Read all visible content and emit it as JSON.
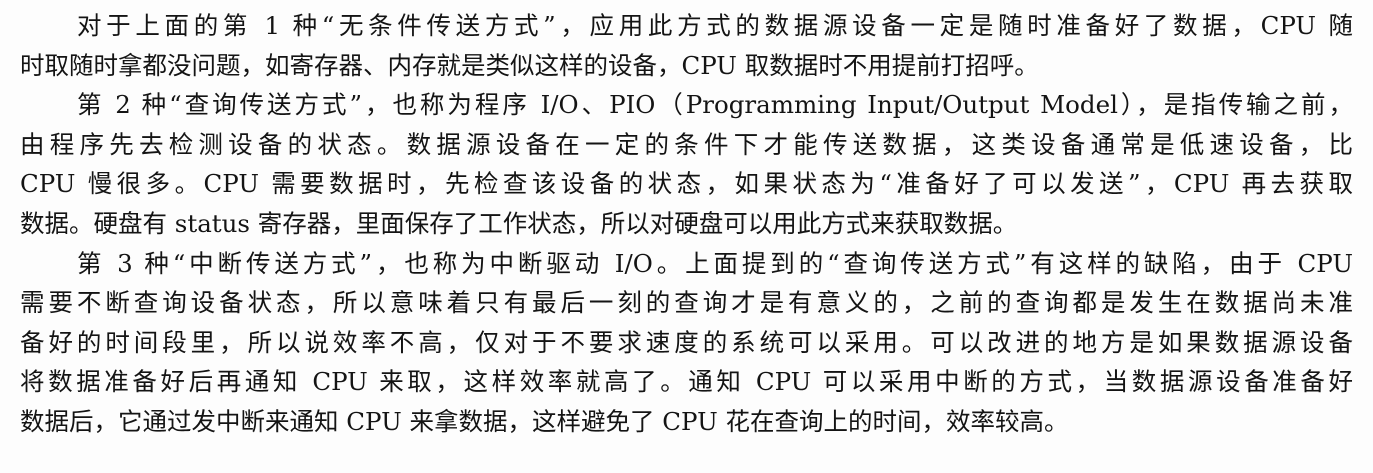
{
  "document": {
    "lines": [
      "对于上面的第 1 种“无条件传送方式”，应用此方式的数据源设备一定是随时准备好了数据，CPU 随",
      "时取随时拿都没问题，如寄存器、内存就是类似这样的设备，CPU 取数据时不用提前打招呼。",
      "第 2 种“查询传送方式”，也称为程序 I/O、PIO（Programming Input/Output Model），是指传输之前，",
      "由程序先去检测设备的状态。数据源设备在一定的条件下才能传送数据，这类设备通常是低速设备，比",
      "CPU 慢很多。CPU 需要数据时，先检查该设备的状态，如果状态为“准备好了可以发送”，CPU 再去获取",
      "数据。硬盘有 status 寄存器，里面保存了工作状态，所以对硬盘可以用此方式来获取数据。",
      "第 3 种“中断传送方式”，也称为中断驱动 I/O。上面提到的“查询传送方式”有这样的缺陷，由于 CPU",
      "需要不断查询设备状态，所以意味着只有最后一刻的查询才是有意义的，之前的查询都是发生在数据尚未准",
      "备好的时间段里，所以说效率不高，仅对于不要求速度的系统可以采用。可以改进的地方是如果数据源设备",
      "将数据准备好后再通知 CPU 来取，这样效率就高了。通知 CPU 可以采用中断的方式，当数据源设备准备好",
      "数据后，它通过发中断来通知 CPU 来拿数据，这样避免了 CPU 花在查询上的时间，效率较高。"
    ]
  }
}
